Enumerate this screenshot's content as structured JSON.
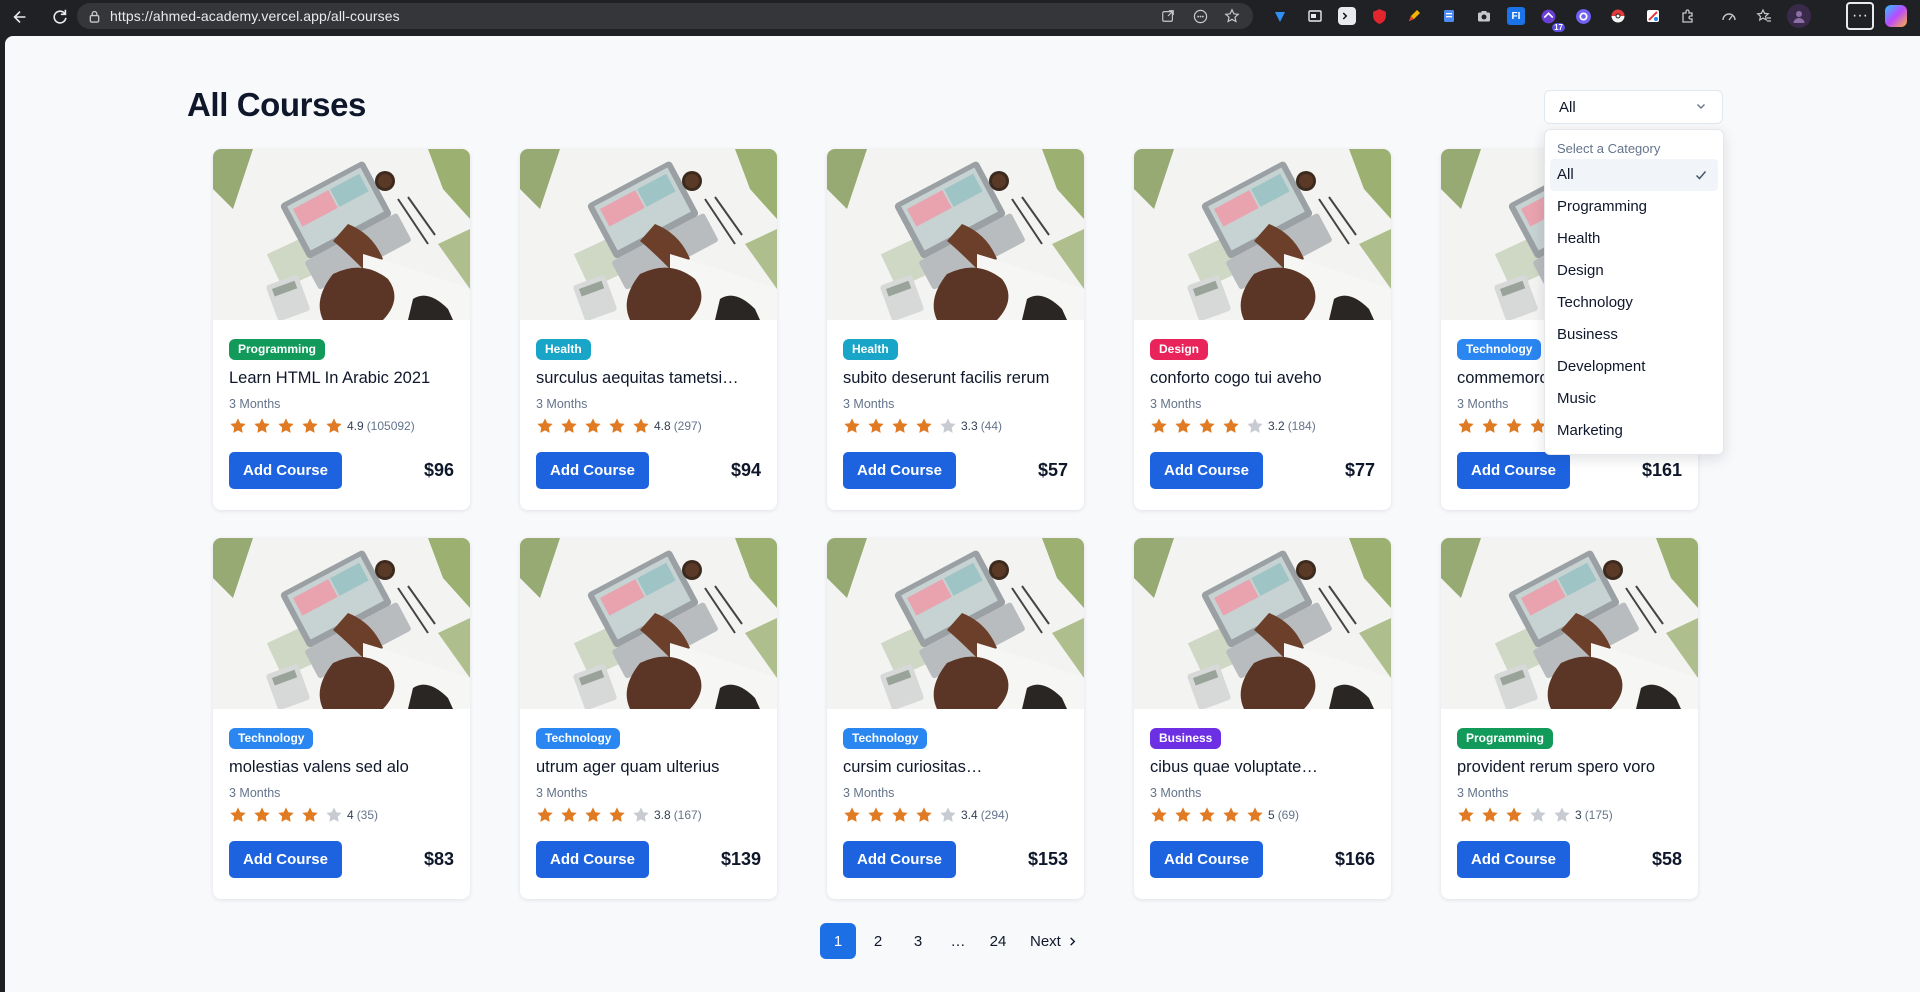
{
  "browser": {
    "url": "https://ahmed-academy.vercel.app/all-courses",
    "extension_count_badge": "17"
  },
  "page": {
    "title": "All Courses"
  },
  "category_select": {
    "selected": "All",
    "menu_label": "Select a Category",
    "options": [
      "All",
      "Programming",
      "Health",
      "Design",
      "Technology",
      "Business",
      "Development",
      "Music",
      "Marketing"
    ]
  },
  "colors": {
    "accent": "#1d63e0",
    "star_filled": "#e07b24",
    "star_empty": "#c8ccd2",
    "Programming": "#129a5b",
    "Health": "#19a5c8",
    "Design": "#e8245a",
    "Technology": "#2a86f0",
    "Business": "#6d2fe3"
  },
  "courses": [
    {
      "category": "Programming",
      "title": "Learn HTML In Arabic 2021",
      "duration": "3 Months",
      "rating": "4.9",
      "stars": 5,
      "reviews": "(105092)",
      "button": "Add Course",
      "price": "$96"
    },
    {
      "category": "Health",
      "title": "surculus aequitas tametsi…",
      "duration": "3 Months",
      "rating": "4.8",
      "stars": 5,
      "reviews": "(297)",
      "button": "Add Course",
      "price": "$94"
    },
    {
      "category": "Health",
      "title": "subito deserunt facilis rerum",
      "duration": "3 Months",
      "rating": "3.3",
      "stars": 4,
      "reviews": "(44)",
      "button": "Add Course",
      "price": "$57"
    },
    {
      "category": "Design",
      "title": "conforto cogo tui aveho",
      "duration": "3 Months",
      "rating": "3.2",
      "stars": 4,
      "reviews": "(184)",
      "button": "Add Course",
      "price": "$77"
    },
    {
      "category": "Technology",
      "title": "commemoro",
      "duration": "3 Months",
      "rating": "",
      "stars": 5,
      "reviews": "",
      "button": "Add Course",
      "price": "$161"
    },
    {
      "category": "Technology",
      "title": "molestias valens sed alo",
      "duration": "3 Months",
      "rating": "4",
      "stars": 4,
      "reviews": "(35)",
      "button": "Add Course",
      "price": "$83"
    },
    {
      "category": "Technology",
      "title": "utrum ager quam ulterius",
      "duration": "3 Months",
      "rating": "3.8",
      "stars": 4,
      "reviews": "(167)",
      "button": "Add Course",
      "price": "$139"
    },
    {
      "category": "Technology",
      "title": "cursim curiositas…",
      "duration": "3 Months",
      "rating": "3.4",
      "stars": 4,
      "reviews": "(294)",
      "button": "Add Course",
      "price": "$153"
    },
    {
      "category": "Business",
      "title": "cibus quae voluptate…",
      "duration": "3 Months",
      "rating": "5",
      "stars": 5,
      "reviews": "(69)",
      "button": "Add Course",
      "price": "$166"
    },
    {
      "category": "Programming",
      "title": "provident rerum spero voro",
      "duration": "3 Months",
      "rating": "3",
      "stars": 3,
      "reviews": "(175)",
      "button": "Add Course",
      "price": "$58"
    }
  ],
  "pagination": {
    "pages": [
      "1",
      "2",
      "3",
      "…",
      "24"
    ],
    "current": "1",
    "next_label": "Next"
  }
}
